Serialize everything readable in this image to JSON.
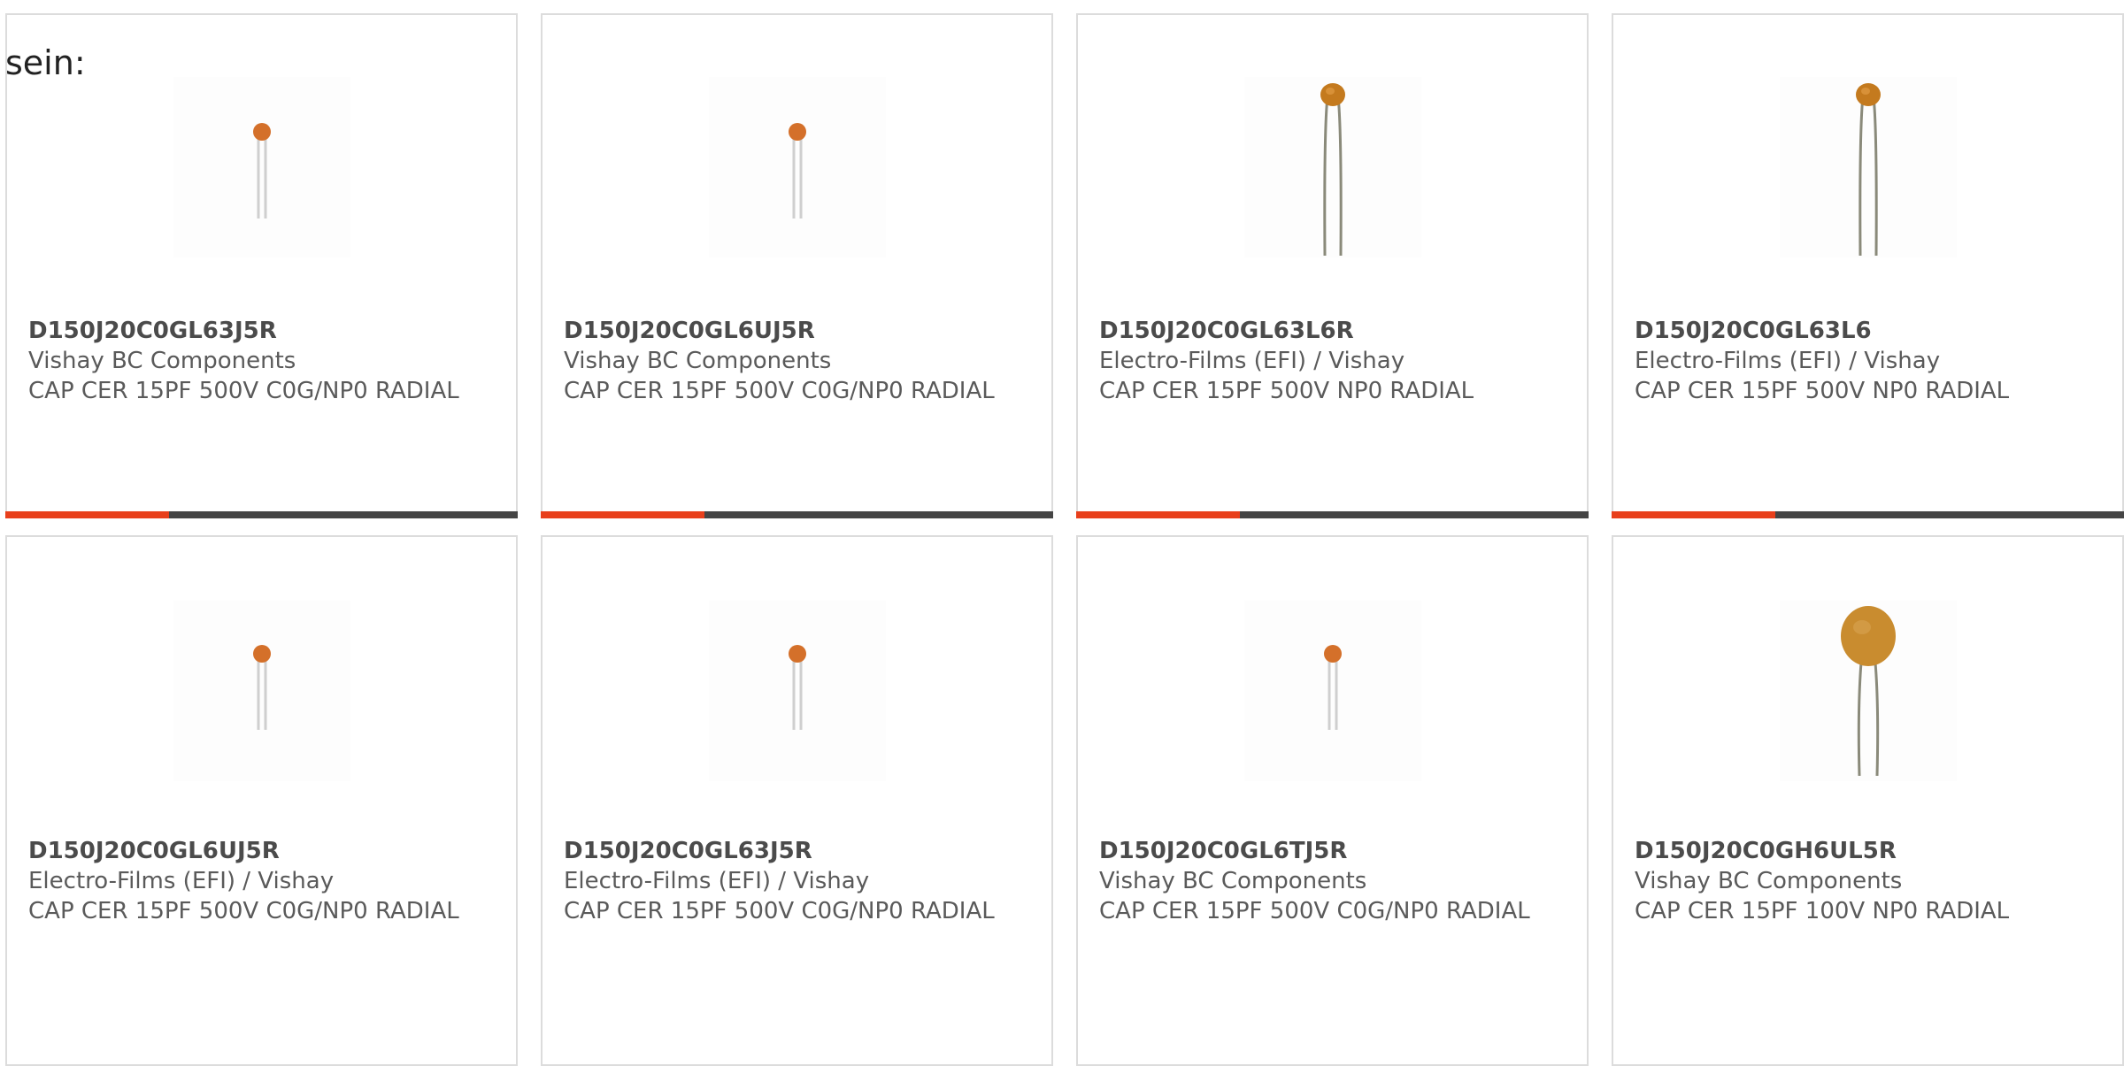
{
  "intro_text": "sein:",
  "colors": {
    "accent": "#e8401c",
    "bar_track": "#454545",
    "border": "#dcdcdc",
    "capacitor_body": "#d4702a",
    "capacitor_disc": "#c98c2f"
  },
  "products": [
    {
      "part_number": "D150J20C0GL63J5R",
      "manufacturer": "Vishay BC Components",
      "description": "CAP CER 15PF 500V C0G/NP0 RADIAL",
      "image_icon": "small-ceramic-capacitor-icon",
      "progress": 0.32
    },
    {
      "part_number": "D150J20C0GL6UJ5R",
      "manufacturer": "Vishay BC Components",
      "description": "CAP CER 15PF 500V C0G/NP0 RADIAL",
      "image_icon": "small-ceramic-capacitor-icon",
      "progress": 0.32
    },
    {
      "part_number": "D150J20C0GL63L6R",
      "manufacturer": "Electro-Films (EFI) / Vishay",
      "description": "CAP CER 15PF 500V NP0 RADIAL",
      "image_icon": "long-lead-ceramic-capacitor-icon",
      "progress": 0.32
    },
    {
      "part_number": "D150J20C0GL63L6",
      "manufacturer": "Electro-Films (EFI) / Vishay",
      "description": "CAP CER 15PF 500V NP0 RADIAL",
      "image_icon": "long-lead-ceramic-capacitor-icon",
      "progress": 0.32
    },
    {
      "part_number": "D150J20C0GL6UJ5R",
      "manufacturer": "Electro-Films (EFI) / Vishay",
      "description": "CAP CER 15PF 500V C0G/NP0 RADIAL",
      "image_icon": "small-ceramic-capacitor-icon"
    },
    {
      "part_number": "D150J20C0GL63J5R",
      "manufacturer": "Electro-Films (EFI) / Vishay",
      "description": "CAP CER 15PF 500V C0G/NP0 RADIAL",
      "image_icon": "small-ceramic-capacitor-icon"
    },
    {
      "part_number": "D150J20C0GL6TJ5R",
      "manufacturer": "Vishay BC Components",
      "description": "CAP CER 15PF 500V C0G/NP0 RADIAL",
      "image_icon": "small-ceramic-capacitor-icon"
    },
    {
      "part_number": "D150J20C0GH6UL5R",
      "manufacturer": "Vishay BC Components",
      "description": "CAP CER 15PF 100V NP0 RADIAL",
      "image_icon": "disc-ceramic-capacitor-icon"
    }
  ]
}
